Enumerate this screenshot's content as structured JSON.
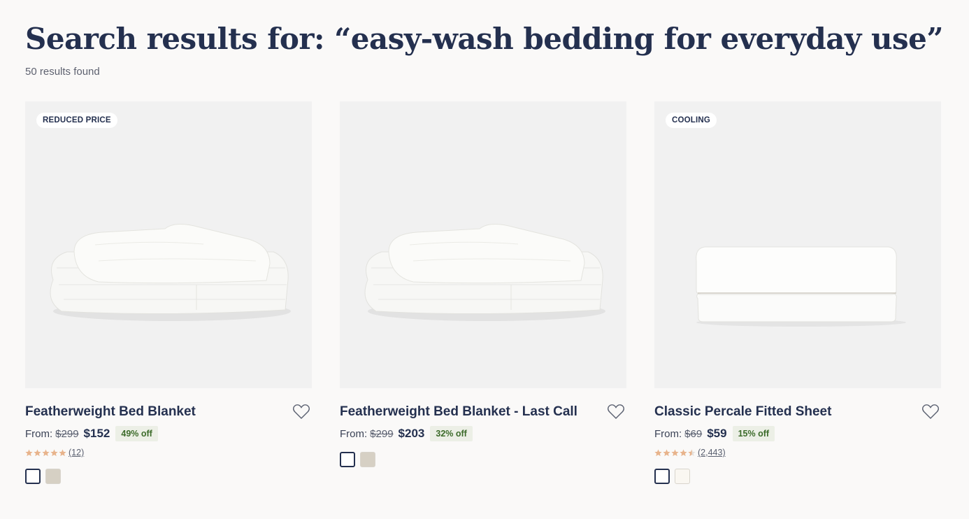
{
  "header": {
    "title": "Search results for: “easy-wash bedding for everyday use”",
    "result_count": "50 results found"
  },
  "colors": {
    "title": "#24304f",
    "discount_bg": "#ecefe6",
    "discount_text": "#3c6b2a",
    "star": "#e8b48c",
    "swatch_selected_border": "#24304f"
  },
  "products": [
    {
      "badge": "REDUCED PRICE",
      "image_icon": "folded-comforter-image",
      "name": "Featherweight Bed Blanket",
      "from_label": "From:",
      "original_price": "$299",
      "sale_price": "$152",
      "discount": "49% off",
      "rating": 5,
      "reviews": "(12)",
      "swatches": [
        {
          "name": "White",
          "color": "#ffffff",
          "selected": true
        },
        {
          "name": "Oat",
          "color": "#d6d0c4",
          "selected": false
        }
      ]
    },
    {
      "badge": "",
      "image_icon": "folded-comforter-image",
      "name": "Featherweight Bed Blanket - Last Call",
      "from_label": "From:",
      "original_price": "$299",
      "sale_price": "$203",
      "discount": "32% off",
      "rating": null,
      "reviews": "",
      "swatches": [
        {
          "name": "White",
          "color": "#ffffff",
          "selected": true
        },
        {
          "name": "Oat",
          "color": "#d6d0c4",
          "selected": false
        }
      ]
    },
    {
      "badge": "COOLING",
      "image_icon": "folded-sheet-image",
      "name": "Classic Percale Fitted Sheet",
      "from_label": "From:",
      "original_price": "$69",
      "sale_price": "$59",
      "discount": "15% off",
      "rating": 4.5,
      "reviews": "(2,443)",
      "swatches": [
        {
          "name": "White",
          "color": "#ffffff",
          "selected": true
        },
        {
          "name": "Cream",
          "color": "#faf7f1",
          "selected": false
        }
      ]
    }
  ]
}
